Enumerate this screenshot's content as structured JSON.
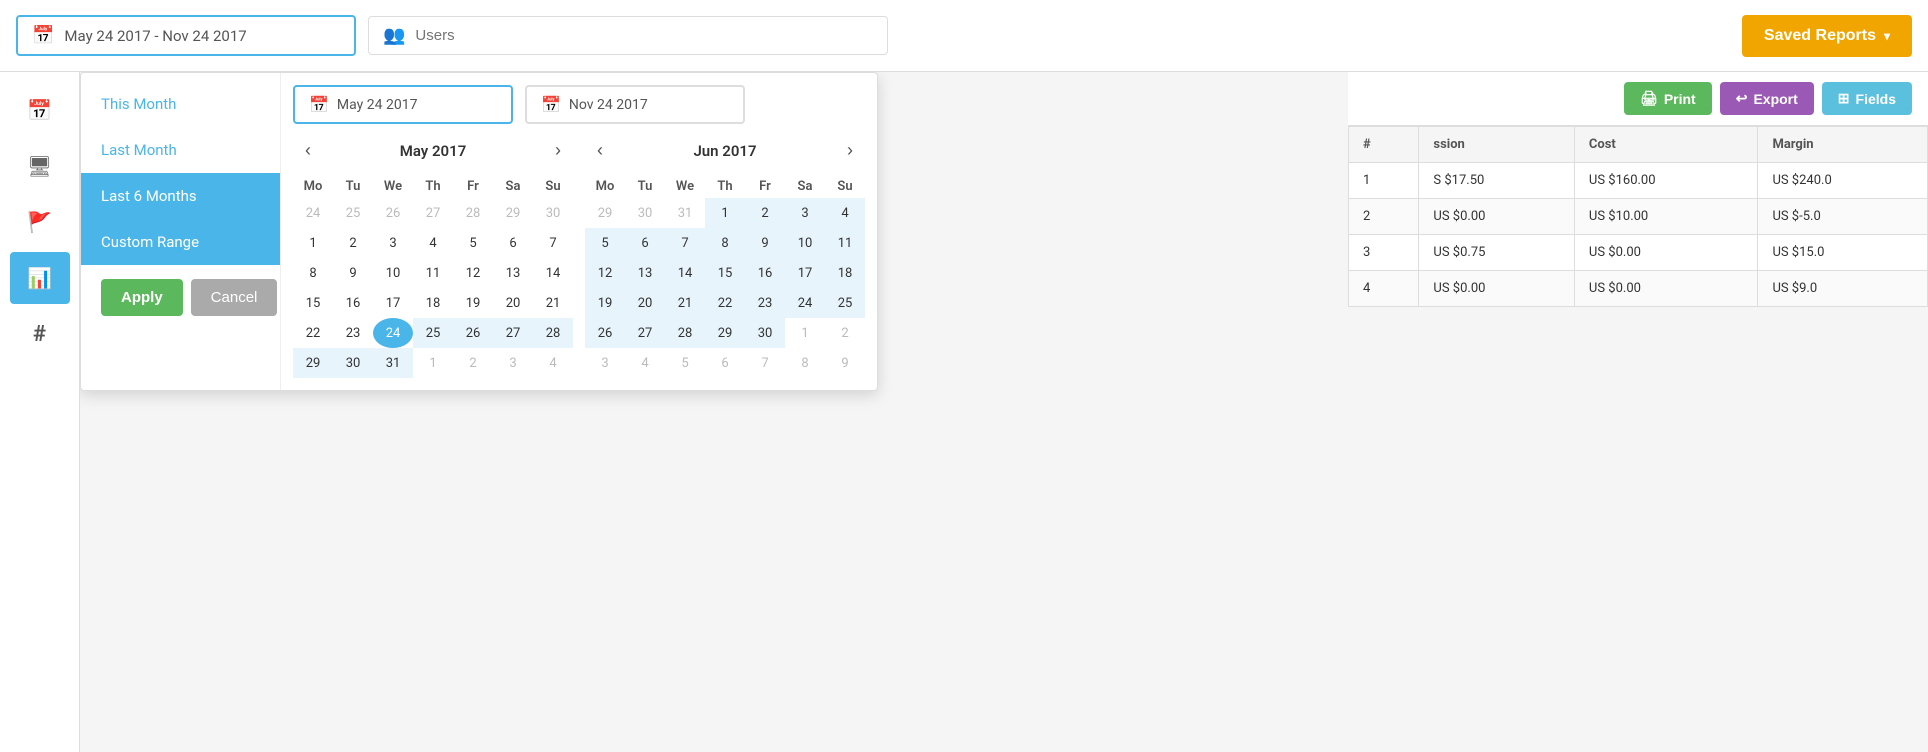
{
  "topbar": {
    "date_range_value": "May 24 2017 - Nov 24 2017",
    "users_placeholder": "Users",
    "saved_reports_label": "Saved Reports"
  },
  "sidebar": {
    "items": [
      {
        "icon": "📅",
        "name": "calendar"
      },
      {
        "icon": "🖥",
        "name": "monitor"
      },
      {
        "icon": "🚩",
        "name": "flag"
      },
      {
        "icon": "📊",
        "name": "chart-active"
      },
      {
        "icon": "#",
        "name": "hash"
      }
    ]
  },
  "dropdown": {
    "presets": [
      {
        "label": "This Month",
        "state": "default"
      },
      {
        "label": "Last Month",
        "state": "default"
      },
      {
        "label": "Last 6 Months",
        "state": "selected"
      },
      {
        "label": "Custom Range",
        "state": "selected"
      }
    ],
    "apply_label": "Apply",
    "cancel_label": "Cancel",
    "start_date_display": "May 24 2017",
    "end_date_display": "Nov 24 2017",
    "left_calendar": {
      "title": "May 2017",
      "days_header": [
        "Mo",
        "Tu",
        "We",
        "Th",
        "Fr",
        "Sa",
        "Su"
      ],
      "weeks": [
        [
          "24",
          "25",
          "26",
          "27",
          "28",
          "29",
          "30"
        ],
        [
          "1",
          "2",
          "3",
          "4",
          "5",
          "6",
          "7"
        ],
        [
          "8",
          "9",
          "10",
          "11",
          "12",
          "13",
          "14"
        ],
        [
          "15",
          "16",
          "17",
          "18",
          "19",
          "20",
          "21"
        ],
        [
          "22",
          "23",
          "24",
          "25",
          "26",
          "27",
          "28"
        ],
        [
          "29",
          "30",
          "31",
          "1",
          "2",
          "3",
          "4"
        ]
      ],
      "other_month_indices": [
        [
          0,
          1,
          2,
          3,
          4,
          5,
          6
        ],
        [],
        [],
        [],
        [],
        [
          3,
          4,
          5,
          6
        ]
      ],
      "selected_cells": [
        [
          4,
          2
        ]
      ],
      "in_range_cells": [
        [
          4,
          3
        ],
        [
          4,
          4
        ],
        [
          4,
          5
        ],
        [
          4,
          6
        ],
        [
          5,
          0
        ],
        [
          5,
          1
        ],
        [
          5,
          2
        ]
      ]
    },
    "right_calendar": {
      "title": "Jun 2017",
      "days_header": [
        "Mo",
        "Tu",
        "We",
        "Th",
        "Fr",
        "Sa",
        "Su"
      ],
      "weeks": [
        [
          "29",
          "30",
          "31",
          "1",
          "2",
          "3",
          "4"
        ],
        [
          "5",
          "6",
          "7",
          "8",
          "9",
          "10",
          "11"
        ],
        [
          "12",
          "13",
          "14",
          "15",
          "16",
          "17",
          "18"
        ],
        [
          "19",
          "20",
          "21",
          "22",
          "23",
          "24",
          "25"
        ],
        [
          "26",
          "27",
          "28",
          "29",
          "30",
          "1",
          "2"
        ],
        [
          "3",
          "4",
          "5",
          "6",
          "7",
          "8",
          "9"
        ]
      ],
      "other_month_indices": [
        [
          0,
          1,
          2
        ],
        [],
        [],
        [],
        [
          5,
          6
        ],
        [
          0,
          1,
          2,
          3,
          4,
          5,
          6
        ]
      ],
      "in_range_cells": [
        [
          0,
          3
        ],
        [
          0,
          4
        ],
        [
          0,
          5
        ],
        [
          0,
          6
        ],
        [
          1,
          0
        ],
        [
          1,
          1
        ],
        [
          1,
          2
        ],
        [
          1,
          3
        ],
        [
          1,
          4
        ],
        [
          1,
          5
        ],
        [
          1,
          6
        ],
        [
          2,
          0
        ],
        [
          2,
          1
        ],
        [
          2,
          2
        ],
        [
          2,
          3
        ],
        [
          2,
          4
        ],
        [
          2,
          5
        ],
        [
          2,
          6
        ],
        [
          3,
          0
        ],
        [
          3,
          1
        ],
        [
          3,
          2
        ],
        [
          3,
          3
        ],
        [
          3,
          4
        ],
        [
          3,
          5
        ],
        [
          3,
          6
        ],
        [
          4,
          0
        ],
        [
          4,
          1
        ],
        [
          4,
          2
        ],
        [
          4,
          3
        ],
        [
          4,
          4
        ]
      ]
    }
  },
  "table": {
    "toolbar": {
      "print_label": "Print",
      "export_label": "Export",
      "fields_label": "Fields"
    },
    "headers": [
      "#",
      "...",
      "ssion",
      "Cost",
      "Margin"
    ],
    "rows": [
      {
        "num": "1",
        "ssion": "S $17.50",
        "cost": "US $160.00",
        "margin": "US $240.0"
      },
      {
        "num": "2",
        "ssion": "US $0.00",
        "cost": "US $10.00",
        "margin": "US $-5.0"
      },
      {
        "num": "3",
        "ssion": "US $0.75",
        "cost": "US $0.00",
        "margin": "US $15.0"
      },
      {
        "num": "4",
        "ssion": "US $0.00",
        "cost": "US $0.00",
        "margin": "US $9.0"
      }
    ]
  }
}
